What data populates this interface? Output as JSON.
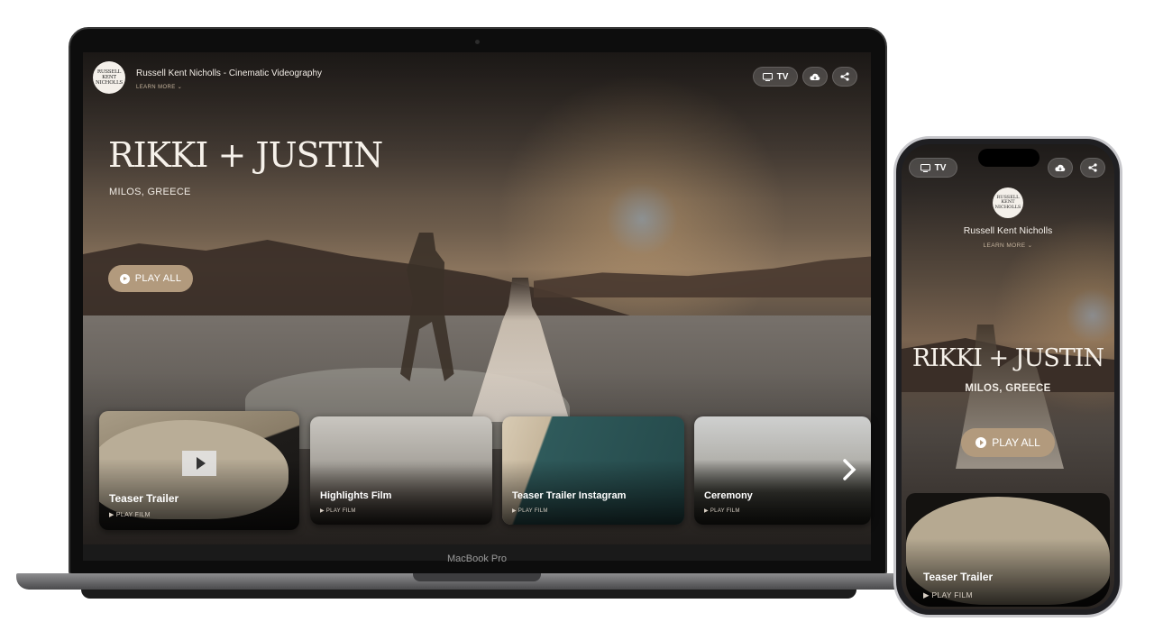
{
  "laptop": {
    "brand_label": "MacBook Pro",
    "header": {
      "logo_text": "RUSSELL KENT NICHOLLS",
      "title": "Russell Kent Nicholls - Cinematic Videography",
      "learn_more": "LEARN MORE ⌄",
      "tv_label": "TV"
    },
    "hero": {
      "title": "RIKKI + JUSTIN",
      "location": "MILOS, GREECE",
      "play_all": "PLAY ALL"
    },
    "films": [
      {
        "title": "Teaser Trailer",
        "play": "▶ PLAY FILM"
      },
      {
        "title": "Highlights Film",
        "play": "▶ PLAY FILM"
      },
      {
        "title": "Teaser Trailer Instagram",
        "play": "▶ PLAY FILM"
      },
      {
        "title": "Ceremony",
        "play": "▶ PLAY FILM"
      }
    ]
  },
  "phone": {
    "tv_label": "TV",
    "logo_text": "RUSSELL KENT NICHOLLS",
    "name": "Russell Kent Nicholls",
    "learn_more": "LEARN MORE ⌄",
    "hero": {
      "title": "RIKKI + JUSTIN",
      "location": "MILOS, GREECE",
      "play_all": "PLAY ALL"
    },
    "film": {
      "title": "Teaser Trailer",
      "play": "▶ PLAY FILM"
    }
  },
  "colors": {
    "accent": "#b29a7d",
    "learn_more": "#c6b49e"
  },
  "icons": [
    "tv-icon",
    "cloud-download-icon",
    "share-icon",
    "play-circle-icon",
    "chevron-right-icon",
    "play-icon"
  ]
}
